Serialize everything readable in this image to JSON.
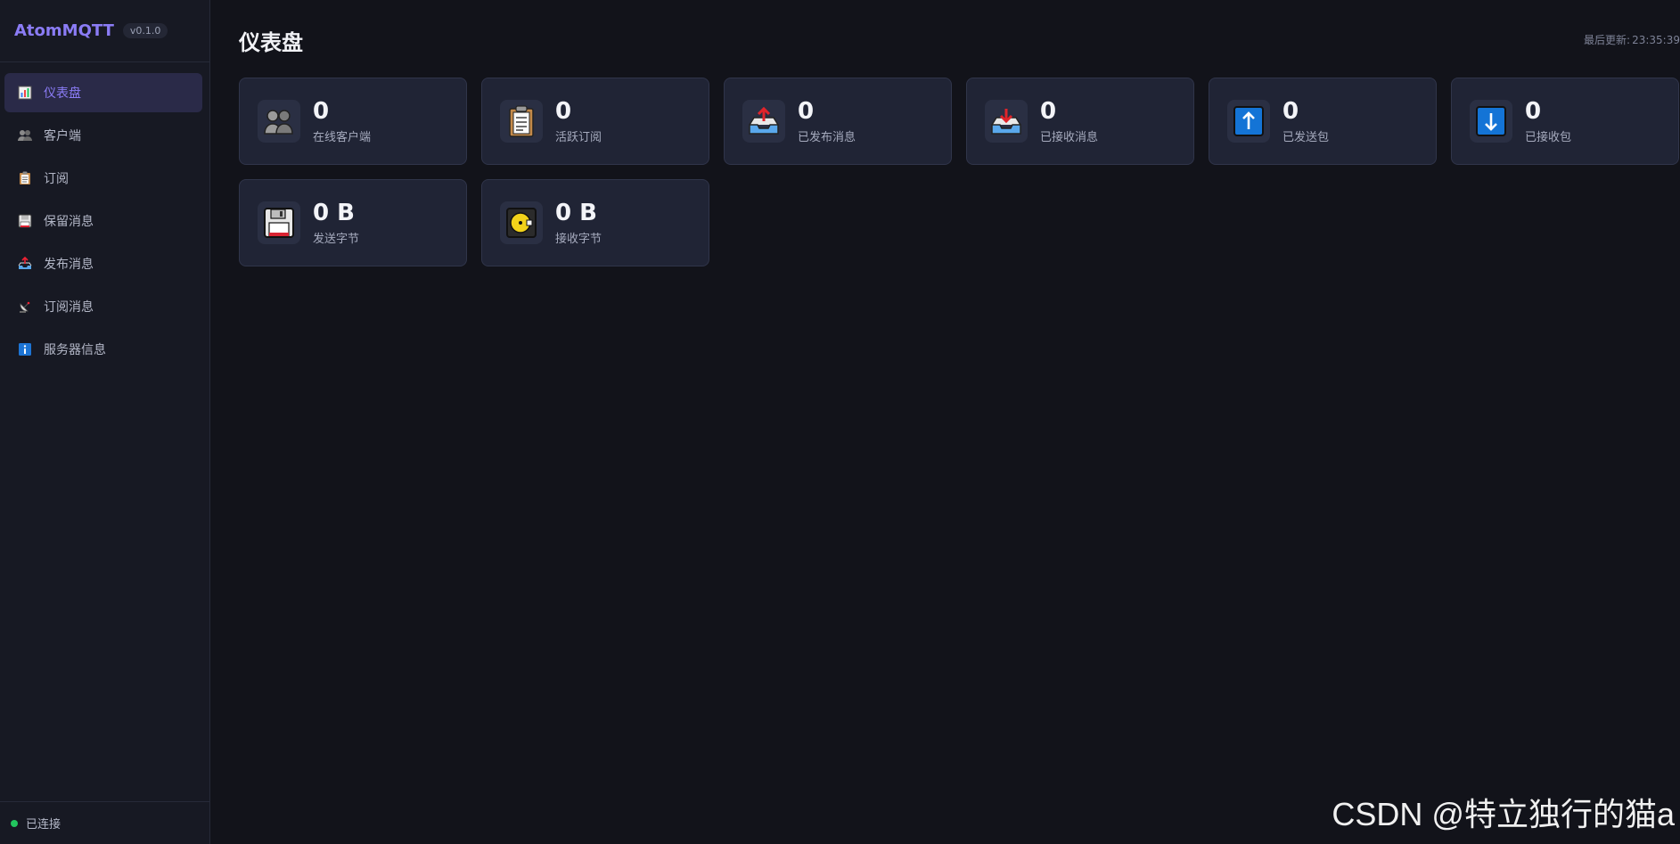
{
  "sidebar": {
    "brand": "AtomMQTT",
    "version": "v0.1.0",
    "items": [
      {
        "label": "仪表盘",
        "icon": "chart-icon"
      },
      {
        "label": "客户端",
        "icon": "users-icon"
      },
      {
        "label": "订阅",
        "icon": "clipboard-icon"
      },
      {
        "label": "保留消息",
        "icon": "floppy-icon"
      },
      {
        "label": "发布消息",
        "icon": "outbox-icon"
      },
      {
        "label": "订阅消息",
        "icon": "satellite-icon"
      },
      {
        "label": "服务器信息",
        "icon": "info-icon"
      }
    ],
    "status": "已连接"
  },
  "header": {
    "title": "仪表盘",
    "last_update_label": "最后更新:",
    "last_update_time": "23:35:39"
  },
  "stats": [
    {
      "value": "0",
      "label": "在线客户端",
      "icon": "users-icon"
    },
    {
      "value": "0",
      "label": "活跃订阅",
      "icon": "clipboard-icon"
    },
    {
      "value": "0",
      "label": "已发布消息",
      "icon": "outbox-icon"
    },
    {
      "value": "0",
      "label": "已接收消息",
      "icon": "inbox-icon"
    },
    {
      "value": "0",
      "label": "已发送包",
      "icon": "arrow-up-icon"
    },
    {
      "value": "0",
      "label": "已接收包",
      "icon": "arrow-down-icon"
    },
    {
      "value": "0 B",
      "label": "发送字节",
      "icon": "floppy-icon"
    },
    {
      "value": "0 B",
      "label": "接收字节",
      "icon": "disk-icon"
    }
  ],
  "watermark": "CSDN @特立独行的猫a",
  "colors": {
    "accent": "#8b7cf6",
    "connected": "#22c55e",
    "background": "#12131a",
    "card": "#202435"
  }
}
